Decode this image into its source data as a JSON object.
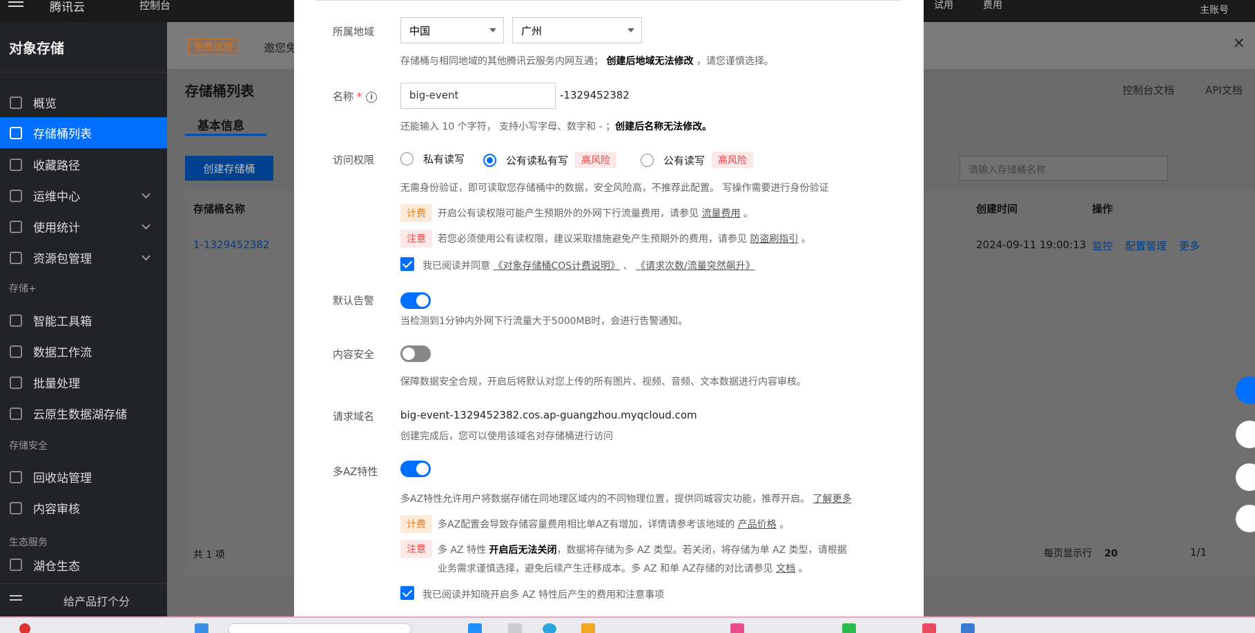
{
  "topbar": {
    "logo": "腾讯云",
    "console": "控制台",
    "trial": "试用",
    "fee": "费用",
    "account": "主账号"
  },
  "sidebar": {
    "title": "对象存储",
    "items": [
      {
        "label": "概览"
      },
      {
        "label": "存储桶列表"
      },
      {
        "label": "收藏路径"
      },
      {
        "label": "运维中心"
      },
      {
        "label": "使用统计"
      },
      {
        "label": "资源包管理"
      },
      {
        "label": "智能工具箱"
      },
      {
        "label": "数据工作流"
      },
      {
        "label": "批量处理"
      },
      {
        "label": "云原生数据湖存储"
      },
      {
        "label": "回收站管理"
      },
      {
        "label": "内容审核"
      },
      {
        "label": "湖仓生态"
      }
    ],
    "groups": [
      "存储+",
      "存储安全",
      "生态服务"
    ],
    "rate": "给产品打个分"
  },
  "main": {
    "free_badge": "免费试用",
    "invite": "邀您免",
    "list_title": "存储桶列表",
    "tab_basic": "基本信息",
    "doc_link": "控制台文档",
    "api_link": "API文档",
    "create_button": "创建存储桶",
    "search_placeholder": "请输入存储桶名称",
    "columns": {
      "name": "存储桶名称",
      "created": "创建时间",
      "ops": "操作"
    },
    "row": {
      "name": "1-1329452382",
      "created": "2024-09-11 19:00:13",
      "monitor": "监控",
      "config": "配置管理",
      "more": "更多"
    },
    "total": "共 1 项",
    "page_size_label": "每页显示行",
    "page_size": "20",
    "page": "1/1"
  },
  "modal": {
    "region": {
      "label": "所属地域",
      "country": "中国",
      "city": "广州",
      "hint_a": "存储桶与相同地域的其他腾讯云服务内网互通；",
      "hint_b": "创建后地域无法修改",
      "hint_c": "，请您谨慎选择。"
    },
    "name": {
      "label": "名称",
      "required": "*",
      "value": "big-event",
      "suffix": "-1329452382",
      "hint_a": "还能输入 10 个字符， 支持小写字母、数字和 - ；",
      "hint_b": "创建后名称无法修改。"
    },
    "access": {
      "label": "访问权限",
      "options": [
        "私有读写",
        "公有读私有写",
        "公有读写"
      ],
      "risk": "高风险",
      "desc": "无需身份验证，即可读取您存储桶中的数据，安全风险高，不推荐此配置。 写操作需要进行身份验证",
      "fee_tag": "计费",
      "fee_text": "开启公有读权限可能产生预期外的外网下行流量费用，请参见",
      "fee_link": "流量费用",
      "note_tag": "注意",
      "note_text": "若您必须使用公有读权限，建议采取措施避免产生预期外的费用，请参见",
      "note_link": "防盗刷指引",
      "agree_text": "我已阅读并同意",
      "agree_link1": "《对象存储桶COS计费说明》",
      "agree_link2": "《请求次数/流量突然飙升》"
    },
    "alarm": {
      "label": "默认告警",
      "desc": "当检测到1分钟内外网下行流量大于5000MB时，会进行告警通知。"
    },
    "content_security": {
      "label": "内容安全",
      "desc": "保障数据安全合规，开启后将默认对您上传的所有图片、视频、音频、文本数据进行内容审核。"
    },
    "domain": {
      "label": "请求域名",
      "value": "big-event-1329452382.cos.ap-guangzhou.myqcloud.com",
      "desc": "创建完成后，您可以使用该域名对存储桶进行访问"
    },
    "multi_az": {
      "label": "多AZ特性",
      "desc": "多AZ特性允许用户将数据存储在同地理区域内的不同物理位置，提供同城容灾功能，推荐开启。",
      "learn_more": "了解更多",
      "fee_tag": "计费",
      "fee_text": "多AZ配置会导致存储容量费用相比单AZ有增加，详情请参考该地域的",
      "fee_link": "产品价格",
      "note_tag": "注意",
      "note_a": "多 AZ 特性",
      "note_b": "开启后无法关闭",
      "note_c": "，数据将存储为多 AZ 类型。若关闭，将存储为单 AZ 类型，请根据",
      "note_d": "业务需求谨慎选择，避免后续产生迁移成本。多 AZ 和单 AZ存储的对比请参见",
      "note_link": "文档",
      "agree_text": "我已阅读并知晓开启多 AZ 特性后产生的费用和注意事项"
    }
  },
  "colors": {
    "primary": "#006eff",
    "danger": "#e54545",
    "warning": "#e5791a"
  }
}
